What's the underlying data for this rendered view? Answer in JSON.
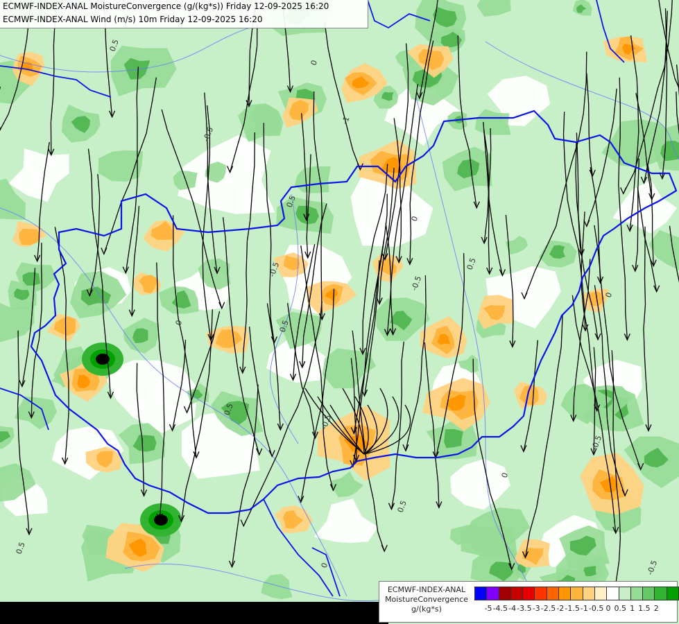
{
  "header": {
    "line1": "ECMWF-INDEX-ANAL MoistureConvergence (g/(kg*s)) Friday 12-09-2025 16:20",
    "line2": "ECMWF-INDEX-ANAL Wind (m/s) 10m Friday 12-09-2025 16:20"
  },
  "legend": {
    "model": "ECMWF-INDEX-ANAL",
    "parameter": "MoistureConvergence",
    "unit": "g/(kg*s)",
    "colors": [
      "#0000ff",
      "#8000ff",
      "#a00000",
      "#c80000",
      "#e80000",
      "#ff3200",
      "#ff6400",
      "#ff9600",
      "#ffb43c",
      "#ffd282",
      "#fff0c8",
      "#ffffff",
      "#c8f0c8",
      "#96dc96",
      "#64c864",
      "#32b432",
      "#00a000"
    ],
    "tick_labels": [
      "-5",
      "-4.5",
      "-4",
      "-3.5",
      "-3",
      "-2.5",
      "-2",
      "-1.5",
      "-1",
      "-0.5",
      "0",
      "0.5",
      "1",
      "1.5",
      "2"
    ]
  },
  "map": {
    "contour_labels": [
      "0.5",
      "0",
      "-0.5",
      "-1",
      "0.5",
      "0",
      "-0.5",
      "0.5",
      "0",
      "-0.5",
      "0.5",
      "0",
      "0.5",
      "-0.5",
      "0.5",
      "0",
      "-0.5",
      "0.5",
      "0",
      "-0.5"
    ],
    "colors": {
      "border": "#0a14e6",
      "river": "#6478ff",
      "green_light": "#c8f0c8",
      "green_mid": "#96dc96",
      "green_dark": "#4cb44c",
      "orange_light": "#ffd282",
      "orange_mid": "#ffb43c",
      "orange_dark": "#ff9600",
      "streamline": "#000000"
    }
  }
}
